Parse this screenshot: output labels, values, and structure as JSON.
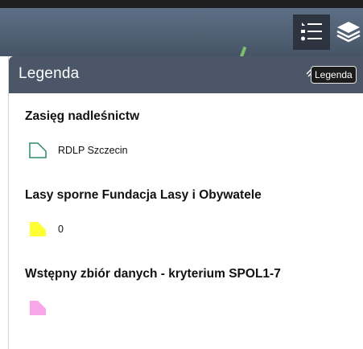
{
  "toolbar": {
    "legend_icon": "legend-list-icon",
    "layers_icon": "layers-icon"
  },
  "panel": {
    "title": "Legenda",
    "collapse_icon": "double-chevron-icon",
    "tooltip": "Legenda"
  },
  "layers": [
    {
      "title": "Zasięg nadleśnictw",
      "items": [
        {
          "label": "RDLP Szczecin",
          "symbol": "outline-polygon",
          "color": "#2e8b6a"
        }
      ]
    },
    {
      "title": "Lasy sporne Fundacja Lasy i Obywatele",
      "items": [
        {
          "label": "0",
          "symbol": "filled-polygon",
          "color": "#ffff33"
        }
      ]
    },
    {
      "title": "Wstępny zbiór danych - kryterium SPOL1-7",
      "items": [
        {
          "label": "",
          "symbol": "filled-polygon",
          "color": "#f7a6e8"
        }
      ]
    }
  ],
  "colors": {
    "header_bg": "#4b5668",
    "toolbar_bg": "#505f72",
    "active_tool_bg": "#2d3440"
  }
}
